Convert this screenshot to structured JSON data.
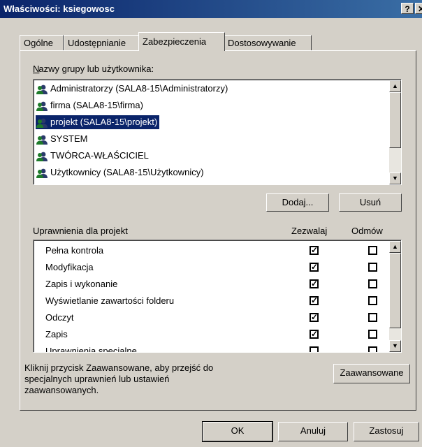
{
  "window": {
    "title": "Właściwości: ksiegowosc",
    "help_btn": "?",
    "close_btn": "✕"
  },
  "tabs": [
    {
      "label": "Ogólne",
      "active": false
    },
    {
      "label": "Udostępnianie",
      "active": false
    },
    {
      "label": "Zabezpieczenia",
      "active": true
    },
    {
      "label": "Dostosowywanie",
      "active": false
    }
  ],
  "groups": {
    "label": "Nazwy grupy lub użytkownika:",
    "items": [
      {
        "label": "Administratorzy (SALA8-15\\Administratorzy)",
        "selected": false,
        "icon": "user-group-icon"
      },
      {
        "label": "firma (SALA8-15\\firma)",
        "selected": false,
        "icon": "user-group-icon"
      },
      {
        "label": "projekt (SALA8-15\\projekt)",
        "selected": true,
        "icon": "user-icon"
      },
      {
        "label": "SYSTEM",
        "selected": false,
        "icon": "user-group-icon"
      },
      {
        "label": "TWÓRCA-WŁAŚCICIEL",
        "selected": false,
        "icon": "user-group-icon"
      },
      {
        "label": "Użytkownicy (SALA8-15\\Użytkownicy)",
        "selected": false,
        "icon": "user-group-icon"
      }
    ],
    "add_button": "Dodaj...",
    "remove_button": "Usuń"
  },
  "permissions": {
    "label": "Uprawnienia dla projekt",
    "col_allow": "Zezwalaj",
    "col_deny": "Odmów",
    "rows": [
      {
        "label": "Pełna kontrola",
        "allow": true,
        "deny": false
      },
      {
        "label": "Modyfikacja",
        "allow": true,
        "deny": false
      },
      {
        "label": "Zapis i wykonanie",
        "allow": true,
        "deny": false
      },
      {
        "label": "Wyświetlanie zawartości folderu",
        "allow": true,
        "deny": false
      },
      {
        "label": "Odczyt",
        "allow": true,
        "deny": false
      },
      {
        "label": "Zapis",
        "allow": true,
        "deny": false
      },
      {
        "label": "Uprawnienia specjalne",
        "allow": false,
        "deny": false
      }
    ]
  },
  "advanced": {
    "text_line1": "Kliknij przycisk Zaawansowane, aby przejść do",
    "text_line2": "specjalnych uprawnień lub ustawień",
    "text_line3": "zaawansowanych.",
    "button": "Zaawansowane"
  },
  "footer": {
    "ok": "OK",
    "cancel": "Anuluj",
    "apply": "Zastosuj"
  }
}
